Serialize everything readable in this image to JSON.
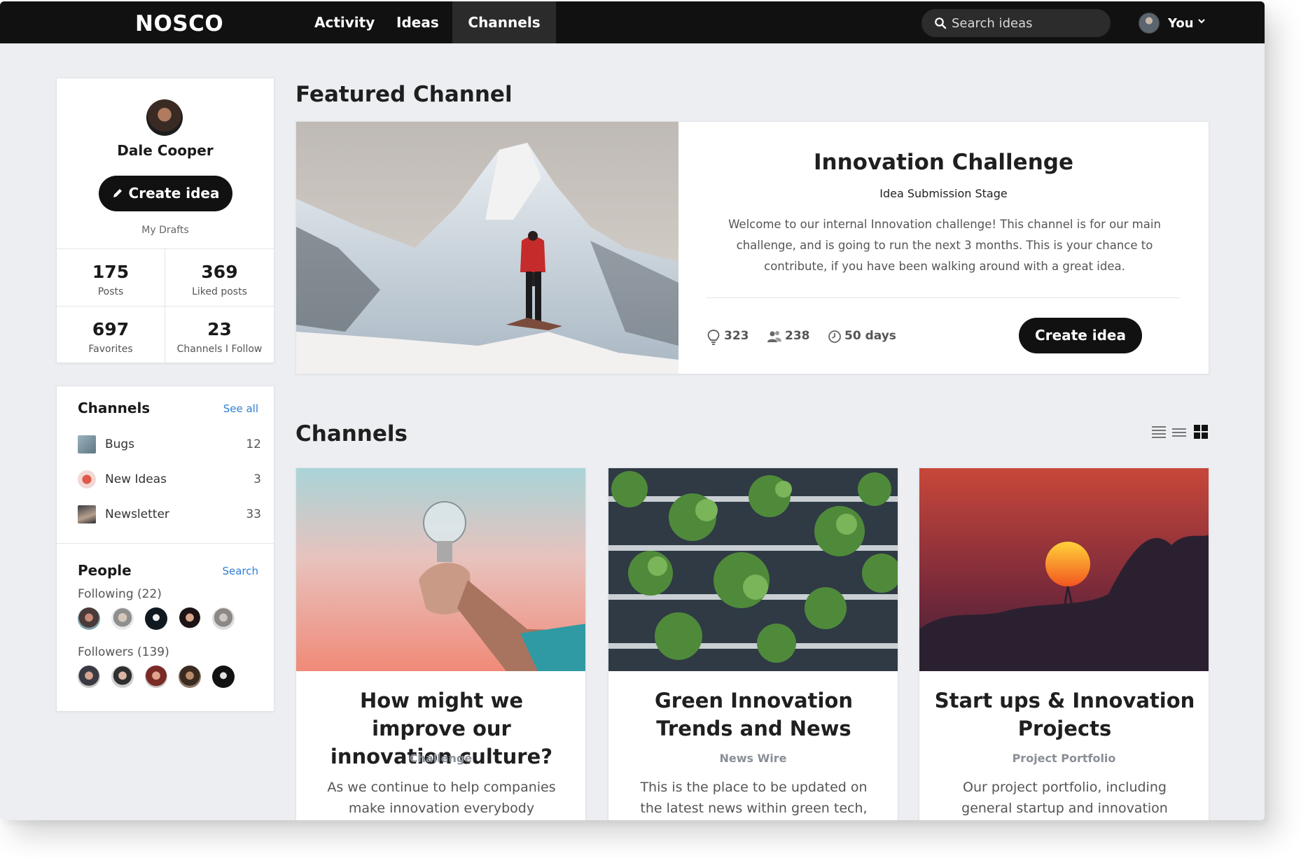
{
  "app": {
    "logo": "NOSCO",
    "nav": {
      "activity": "Activity",
      "ideas": "Ideas",
      "channels": "Channels",
      "active": "Channels"
    },
    "search": {
      "placeholder": "Search ideas"
    },
    "user": {
      "label": "You"
    }
  },
  "profile": {
    "name": "Dale Cooper",
    "create_label": "Create idea",
    "drafts_label": "My Drafts",
    "stats": [
      {
        "value": "175",
        "label": "Posts"
      },
      {
        "value": "369",
        "label": "Liked posts"
      },
      {
        "value": "697",
        "label": "Favorites"
      },
      {
        "value": "23",
        "label": "Channels I Follow"
      }
    ]
  },
  "sidebar_channels": {
    "title": "Channels",
    "link": "See all",
    "items": [
      {
        "name": "Bugs",
        "count": "12"
      },
      {
        "name": "New Ideas",
        "count": "3"
      },
      {
        "name": "Newsletter",
        "count": "33"
      }
    ]
  },
  "people": {
    "title": "People",
    "link": "Search",
    "following_label": "Following (22)",
    "followers_label": "Followers (139)"
  },
  "featured": {
    "heading": "Featured Channel",
    "title": "Innovation Challenge",
    "stage": "Idea Submission Stage",
    "description": "Welcome to our internal Innovation challenge! This channel is for our main challenge, and is going to run the next 3 months. This is your chance to contribute, if you have been walking around with a great idea.",
    "ideas_count": "323",
    "members_count": "238",
    "time_left": "50 days",
    "create_label": "Create idea"
  },
  "channels": {
    "heading": "Channels",
    "cards": [
      {
        "title": "How might we improve our innovation culture?",
        "type": "Challenge",
        "description": "As we continue to help companies make innovation everybody business,"
      },
      {
        "title": "Green Innovation Trends and News",
        "type": "News Wire",
        "description": "This is the place to be updated on the latest news within green tech,"
      },
      {
        "title": "Start ups & Innovation Projects",
        "type": "Project Portfolio",
        "description": "Our project portfolio, including general startup and innovation"
      }
    ]
  },
  "icons": {
    "search": "search-icon",
    "chevron": "chevron-down-icon",
    "pencil": "pencil-icon",
    "bulb": "lightbulb-icon",
    "people": "people-icon",
    "clock": "clock-icon",
    "list_view": "list-view-icon",
    "compact_view": "compact-list-icon",
    "grid_view": "grid-view-icon"
  },
  "colors": {
    "topbar": "#111111",
    "link": "#2f7fd6",
    "background": "#eceef2",
    "button": "#111111"
  }
}
